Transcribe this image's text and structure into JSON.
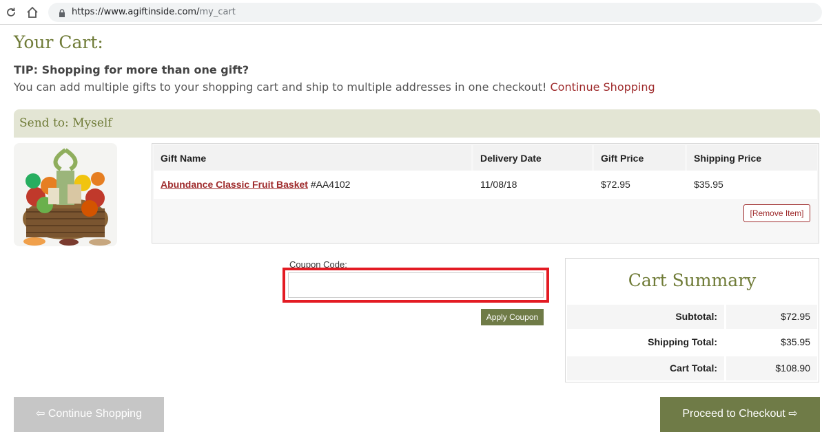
{
  "browser": {
    "url_host": "https://www.agiftinside.com/",
    "url_path": "my_cart"
  },
  "page": {
    "title": "Your Cart:",
    "tip_title": "TIP: Shopping for more than one gift?",
    "tip_text": "You can add multiple gifts to your shopping cart and ship to multiple addresses in one checkout!",
    "tip_link": "Continue Shopping"
  },
  "recipient": {
    "label": "Send to: Myself"
  },
  "items_table": {
    "headers": [
      "Gift Name",
      "Delivery Date",
      "Gift Price",
      "Shipping Price"
    ],
    "rows": [
      {
        "gift_name": "Abundance Classic Fruit Basket",
        "sku": "#AA4102",
        "delivery_date": "11/08/18",
        "gift_price": "$72.95",
        "shipping_price": "$35.95"
      }
    ],
    "remove_label": "[Remove Item]"
  },
  "coupon": {
    "label": "Coupon Code:",
    "value": "",
    "apply_label": "Apply Coupon"
  },
  "summary": {
    "title": "Cart Summary",
    "rows": [
      {
        "label": "Subtotal:",
        "value": "$72.95"
      },
      {
        "label": "Shipping Total:",
        "value": "$35.95"
      },
      {
        "label": "Cart Total:",
        "value": "$108.90"
      }
    ]
  },
  "actions": {
    "continue_label": "⇦ Continue Shopping",
    "checkout_label": "Proceed to Checkout ⇨"
  },
  "colors": {
    "accent": "#6f7b37",
    "link": "#9e2a2b",
    "highlight": "#e31b23",
    "header_bar": "#e3e5d4"
  }
}
